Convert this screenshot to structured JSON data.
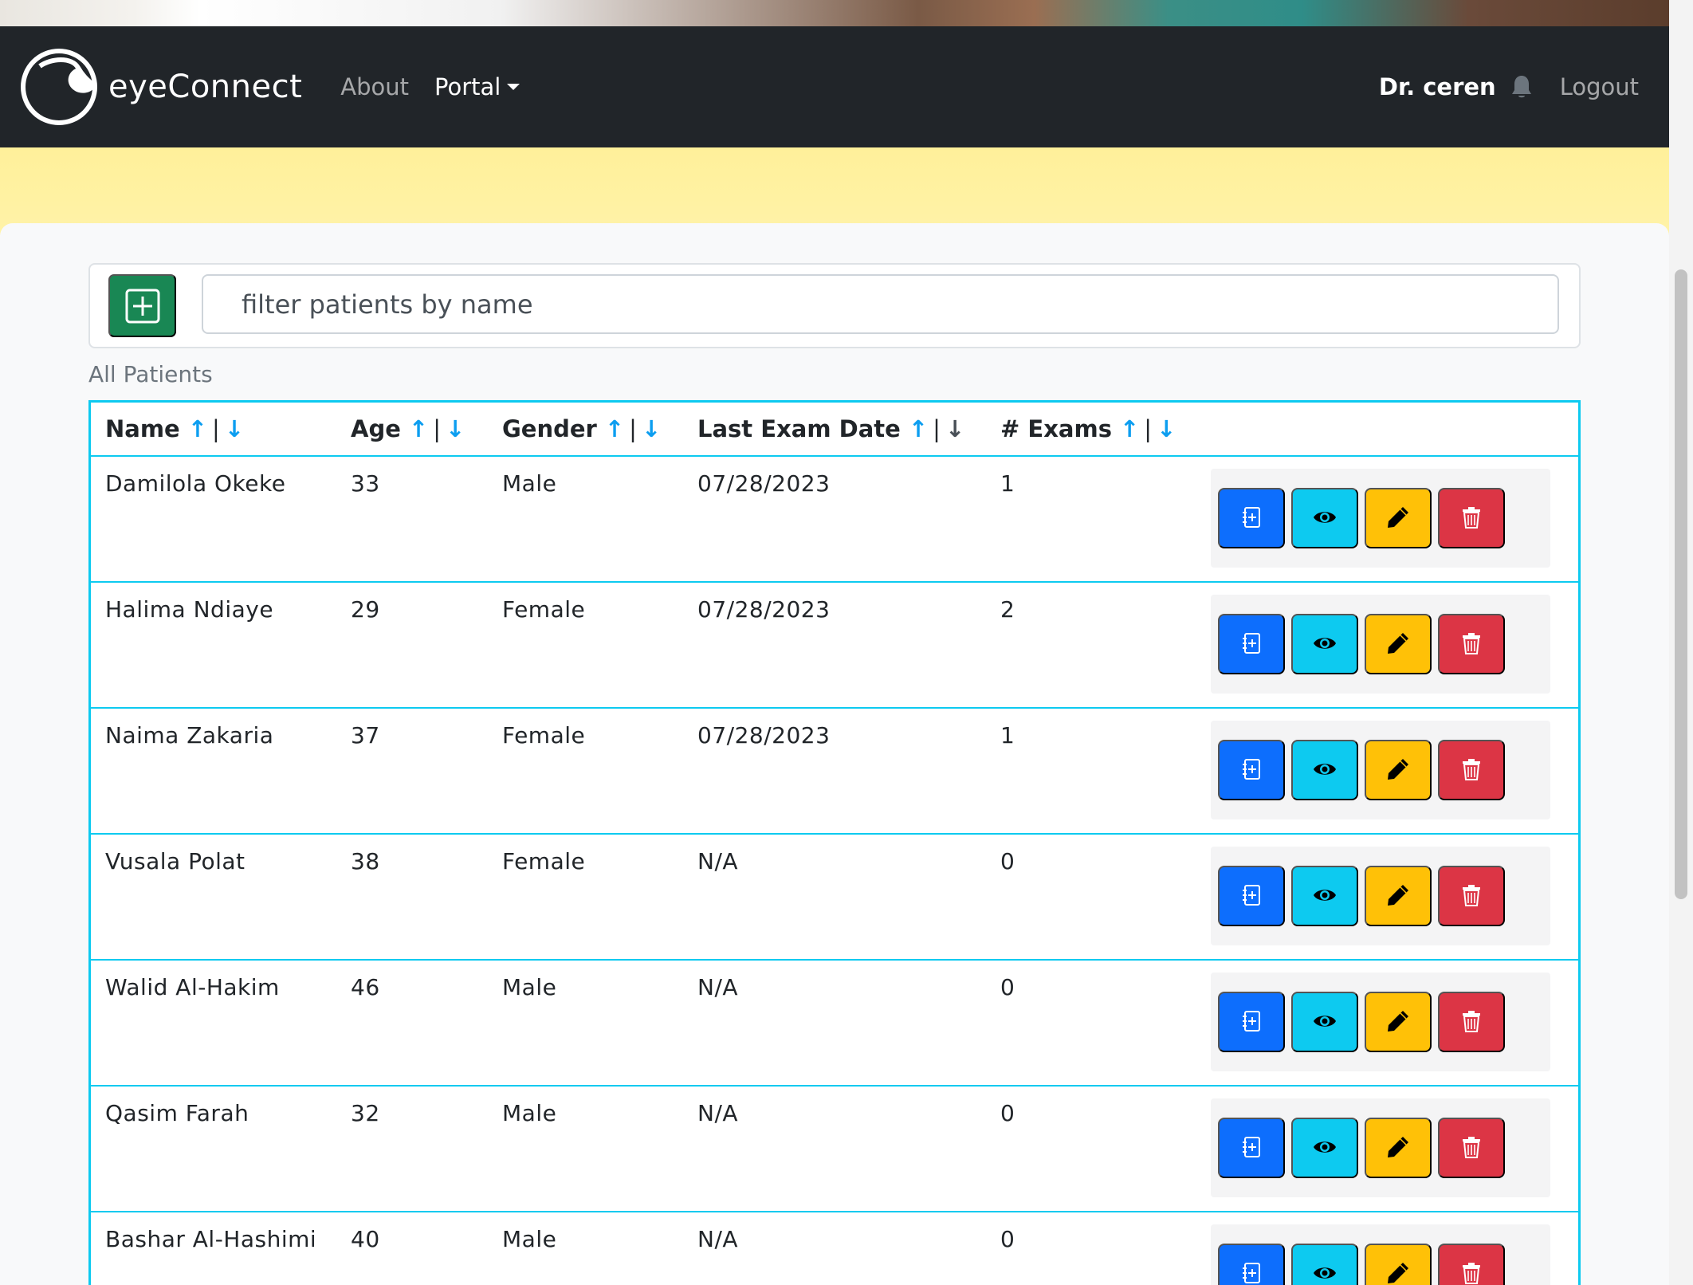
{
  "app": {
    "brand": "eyeConnect"
  },
  "nav": {
    "about": "About",
    "portal": "Portal",
    "user": "Dr. ceren",
    "logout": "Logout"
  },
  "toolbar": {
    "search_placeholder": "filter patients by name",
    "add_icon": "plus-square-icon"
  },
  "table": {
    "caption": "All Patients",
    "sort_up": "↑",
    "sort_sep": "|",
    "sort_down": "↓",
    "columns": [
      "Name",
      "Age",
      "Gender",
      "Last Exam Date",
      "# Exams"
    ],
    "rows": [
      {
        "name": "Damilola Okeke",
        "age": "33",
        "gender": "Male",
        "last_exam": "07/28/2023",
        "exams": "1"
      },
      {
        "name": "Halima Ndiaye",
        "age": "29",
        "gender": "Female",
        "last_exam": "07/28/2023",
        "exams": "2"
      },
      {
        "name": "Naima Zakaria",
        "age": "37",
        "gender": "Female",
        "last_exam": "07/28/2023",
        "exams": "1"
      },
      {
        "name": "Vusala Polat",
        "age": "38",
        "gender": "Female",
        "last_exam": "N/A",
        "exams": "0"
      },
      {
        "name": "Walid Al-Hakim",
        "age": "46",
        "gender": "Male",
        "last_exam": "N/A",
        "exams": "0"
      },
      {
        "name": "Qasim Farah",
        "age": "32",
        "gender": "Male",
        "last_exam": "N/A",
        "exams": "0"
      },
      {
        "name": "Bashar Al-Hashimi",
        "age": "40",
        "gender": "Male",
        "last_exam": "N/A",
        "exams": "0"
      }
    ],
    "row_actions": [
      "journal-plus-icon",
      "eye-icon",
      "pencil-icon",
      "trash-icon"
    ]
  },
  "colors": {
    "navbar": "#212529",
    "banner": "#fff09a",
    "table_border": "#0dcaf0",
    "add": "#198754",
    "primary": "#0d6efd",
    "info": "#0dcaf0",
    "warning": "#ffc107",
    "danger": "#dc3545"
  }
}
